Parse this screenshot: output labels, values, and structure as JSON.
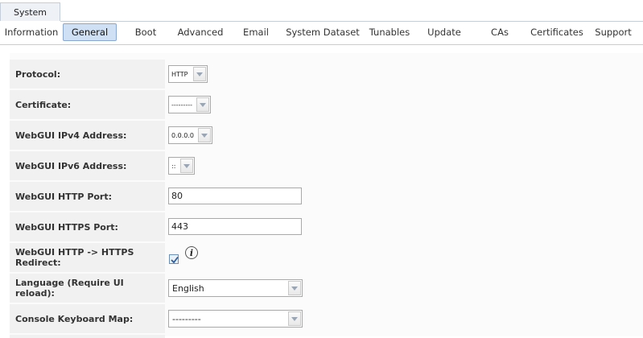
{
  "top_tab": {
    "label": "System"
  },
  "sub_tabs": [
    {
      "label": "Information"
    },
    {
      "label": "General",
      "active": true
    },
    {
      "label": "Boot"
    },
    {
      "label": "Advanced"
    },
    {
      "label": "Email"
    },
    {
      "label": "System Dataset"
    },
    {
      "label": "Tunables"
    },
    {
      "label": "Update"
    },
    {
      "label": "CAs"
    },
    {
      "label": "Certificates"
    },
    {
      "label": "Support"
    }
  ],
  "form": {
    "protocol": {
      "label": "Protocol:",
      "value": "HTTP"
    },
    "certificate": {
      "label": "Certificate:",
      "value": "---------"
    },
    "ipv4": {
      "label": "WebGUI IPv4 Address:",
      "value": "0.0.0.0"
    },
    "ipv6": {
      "label": "WebGUI IPv6 Address:",
      "value": "::"
    },
    "http_port": {
      "label": "WebGUI HTTP Port:",
      "value": "80"
    },
    "https_port": {
      "label": "WebGUI HTTPS Port:",
      "value": "443"
    },
    "redirect": {
      "label": "WebGUI HTTP -> HTTPS Redirect:",
      "checked": true,
      "info_icon": "info-icon",
      "info_glyph": "i"
    },
    "language": {
      "label": "Language (Require UI reload):",
      "value": "English"
    },
    "keymap": {
      "label": "Console Keyboard Map:",
      "value": "---------"
    }
  },
  "colors": {
    "active_tab": "#cfe0f5",
    "label_bg": "#f1f1f1",
    "border": "#c4cdd8"
  },
  "icons": {
    "dropdown": "chevron-down-icon",
    "check": "checkmark-icon"
  }
}
